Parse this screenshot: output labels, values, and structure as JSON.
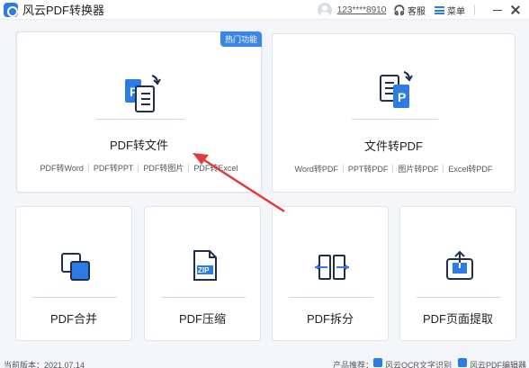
{
  "app": {
    "title": "风云PDF转换器"
  },
  "header": {
    "username": "123****8910",
    "support_label": "客服",
    "menu_label": "菜单"
  },
  "cards": {
    "pdf_to_file": {
      "badge": "热门功能",
      "title": "PDF转文件",
      "subs": [
        "PDF转Word",
        "PDF转PPT",
        "PDF转图片",
        "PDF转Excel"
      ]
    },
    "file_to_pdf": {
      "title": "文件转PDF",
      "subs": [
        "Word转PDF",
        "PPT转PDF",
        "图片转PDF",
        "Excel转PDF"
      ]
    },
    "merge": {
      "title": "PDF合并"
    },
    "compress": {
      "title": "PDF压缩",
      "icon_text": "ZIP"
    },
    "split": {
      "title": "PDF拆分"
    },
    "extract": {
      "title": "PDF页面提取"
    }
  },
  "footer": {
    "version": "当前版本：2021.07.14",
    "recommend_label": "产品推荐：",
    "links": [
      "风云OCR文字识别",
      "风云PDF编辑器"
    ]
  },
  "colors": {
    "accent": "#2d7be5",
    "badge": "#3a86e8",
    "arrow": "#e23b3b",
    "background": "#f3f5f8"
  },
  "icons": {
    "pdf_to_file": "pdf-to-doc-icon",
    "file_to_pdf": "doc-to-pdf-icon",
    "merge": "merge-squares-icon",
    "compress": "zip-file-icon",
    "split": "split-arrows-icon",
    "extract": "extract-page-icon"
  }
}
